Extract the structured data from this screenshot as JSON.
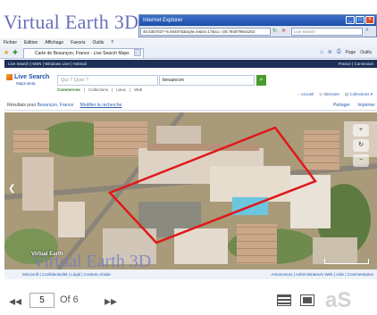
{
  "slide": {
    "title": "Virtual Earth 3D",
    "overlay_title": "Virtual Earth 3D"
  },
  "ie": {
    "title": "Internet Explorer",
    "address": "46.6357037~5.944075&style=h&lvl=17&sc=-39.794979944254",
    "search_placeholder": "Live Search",
    "tab_title": "Carte de Besançon, France - Live Search Maps"
  },
  "menu": [
    "Fichier",
    "Edition",
    "Affichage",
    "Favoris",
    "Outils",
    "?"
  ],
  "cmdbar": {
    "page": "Page",
    "tools": "Outils"
  },
  "livebar": {
    "left": "Live Search  |  MSN  |  Windows Live  |  Hotmail",
    "right": "France  |  Connexion"
  },
  "search": {
    "logo": "Live Search",
    "logo_sub": "Maps Beta",
    "what_placeholder": "Qui ? Quoi ?",
    "where_value": "besancon",
    "tabs": [
      "Commerces",
      "Collections",
      "Lieux",
      "Web"
    ],
    "right_links": [
      "Accueil",
      "Itinéraire",
      "Collections"
    ]
  },
  "results": {
    "prefix": "Résultats pour",
    "location": "Besançon, France",
    "modify": "Modifier la recherche",
    "share": "Partager",
    "print": "Imprimer"
  },
  "map": {
    "label": "Virtual Earth",
    "scale": ""
  },
  "map_footer": {
    "left": "Microsoft  |  Confidentialité  |  Légal  |  Contenu d'aide",
    "right": "Annonceurs  |  Administrateurs Web  |  Aide  |  Commentaires"
  },
  "viewer": {
    "page": "5",
    "of": "Of 6",
    "prev_icon": "double-chevron-left",
    "next_icon": "double-chevron-right",
    "logo": "aS"
  }
}
